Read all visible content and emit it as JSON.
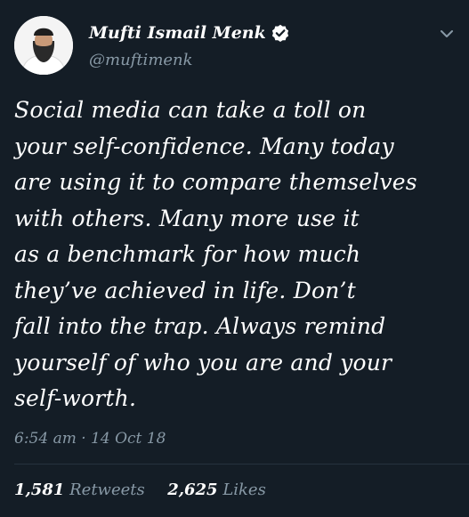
{
  "header": {
    "display_name": "Mufti Ismail Menk",
    "handle": "@muftimenk",
    "verified_icon": "verified-badge-icon",
    "menu_icon": "chevron-down-icon"
  },
  "tweet": {
    "lines": [
      "Social media can take a toll on",
      "your self-confidence. Many today",
      "are using it to compare themselves",
      "with others. Many more use it",
      "as a benchmark for how much",
      "they’ve achieved in life. Don’t",
      "fall into the trap.  Always remind",
      "yourself of who you are and your",
      "self-worth."
    ],
    "timestamp": "6:54 am · 14 Oct 18"
  },
  "stats": {
    "retweets_count": "1,581",
    "retweets_label": "Retweets",
    "likes_count": "2,625",
    "likes_label": "Likes"
  },
  "colors": {
    "background": "#141d26",
    "primary_text": "#ffffff",
    "secondary_text": "#8899a6"
  }
}
